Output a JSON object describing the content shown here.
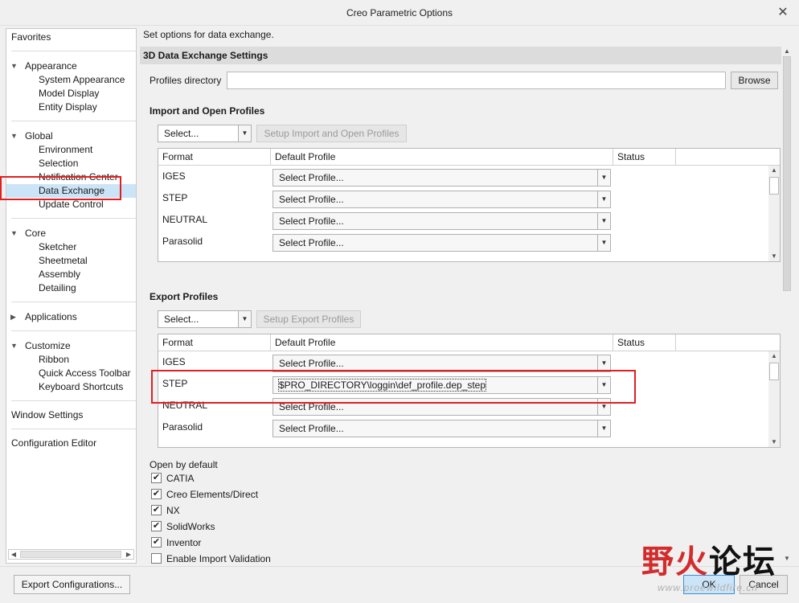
{
  "window": {
    "title": "Creo Parametric Options"
  },
  "sidebar": {
    "favorites": "Favorites",
    "appearance": {
      "label": "Appearance",
      "items": [
        "System Appearance",
        "Model Display",
        "Entity Display"
      ]
    },
    "global": {
      "label": "Global",
      "items": [
        "Environment",
        "Selection",
        "Notification Center",
        "Data Exchange",
        "Update Control"
      ]
    },
    "core": {
      "label": "Core",
      "items": [
        "Sketcher",
        "Sheetmetal",
        "Assembly",
        "Detailing"
      ]
    },
    "applications": "Applications",
    "customize": {
      "label": "Customize",
      "items": [
        "Ribbon",
        "Quick Access Toolbar",
        "Keyboard Shortcuts"
      ]
    },
    "window_settings": "Window Settings",
    "config_editor": "Configuration Editor"
  },
  "main": {
    "description": "Set options for data exchange.",
    "section_title": "3D Data Exchange Settings",
    "profiles_directory_label": "Profiles directory",
    "profiles_directory_value": "",
    "browse_button": "Browse",
    "import": {
      "title": "Import and Open Profiles",
      "select_combo": "Select...",
      "setup_button": "Setup Import and Open Profiles",
      "columns": [
        "Format",
        "Default Profile",
        "Status"
      ],
      "rows": [
        {
          "format": "IGES",
          "profile": "Select Profile..."
        },
        {
          "format": "STEP",
          "profile": "Select Profile..."
        },
        {
          "format": "NEUTRAL",
          "profile": "Select Profile..."
        },
        {
          "format": "Parasolid",
          "profile": "Select Profile..."
        }
      ]
    },
    "export": {
      "title": "Export Profiles",
      "select_combo": "Select...",
      "setup_button": "Setup Export Profiles",
      "columns": [
        "Format",
        "Default Profile",
        "Status"
      ],
      "rows": [
        {
          "format": "IGES",
          "profile": "Select Profile..."
        },
        {
          "format": "STEP",
          "profile": "$PRO_DIRECTORY\\loggin\\def_profile.dep_step"
        },
        {
          "format": "NEUTRAL",
          "profile": "Select Profile..."
        },
        {
          "format": "Parasolid",
          "profile": "Select Profile..."
        }
      ]
    },
    "open_by_default": {
      "label": "Open by default",
      "items": [
        {
          "label": "CATIA",
          "checked": true
        },
        {
          "label": "Creo Elements/Direct",
          "checked": true
        },
        {
          "label": "NX",
          "checked": true
        },
        {
          "label": "SolidWorks",
          "checked": true
        },
        {
          "label": "Inventor",
          "checked": true
        },
        {
          "label": "Enable Import Validation",
          "checked": false
        }
      ]
    }
  },
  "footer": {
    "export_config_button": "Export Configurations...",
    "ok_button": "OK",
    "cancel_button": "Cancel"
  },
  "watermark": {
    "text_red": "野火",
    "text_dark": "论坛",
    "url": "www.proewildfire.cn"
  },
  "icons": {
    "close": "close-icon",
    "expand": "triangle-down-icon",
    "collapse": "triangle-right-icon",
    "dropdown": "chevron-down-icon",
    "check": "check-icon"
  }
}
